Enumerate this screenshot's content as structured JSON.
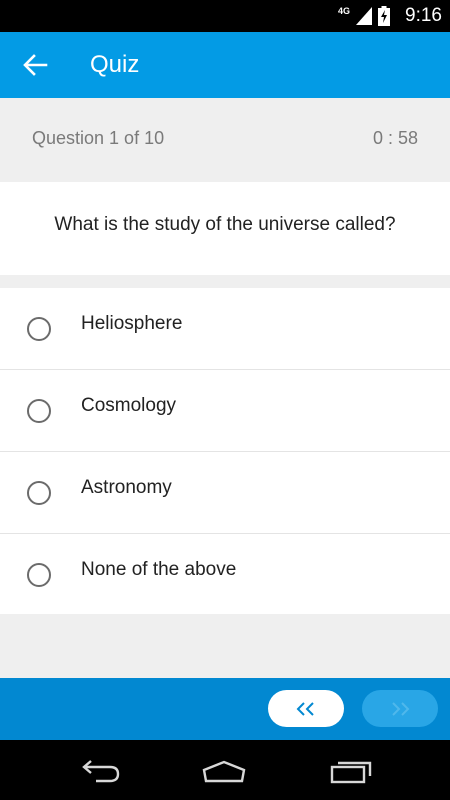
{
  "status_bar": {
    "network": "4G",
    "time": "9:16",
    "icons": [
      "signal-icon",
      "battery-charging-icon"
    ]
  },
  "app_bar": {
    "title": "Quiz",
    "back_icon": "arrow-left-icon"
  },
  "quiz": {
    "progress": "Question 1 of  10",
    "timer": "0 : 58",
    "question": "What is the study of the universe called?",
    "options": [
      {
        "label": "Heliosphere"
      },
      {
        "label": "Cosmology"
      },
      {
        "label": "Astronomy"
      },
      {
        "label": "None of the above"
      }
    ]
  },
  "navigation": {
    "prev_icon": "chevron-double-left-icon",
    "next_icon": "chevron-double-right-icon"
  },
  "system_nav": [
    "back-nav-icon",
    "home-nav-icon",
    "recents-nav-icon"
  ],
  "colors": {
    "primary": "#039be5",
    "bottom_bar": "#0288d1",
    "next_button_disabled": "#29a6e6"
  }
}
